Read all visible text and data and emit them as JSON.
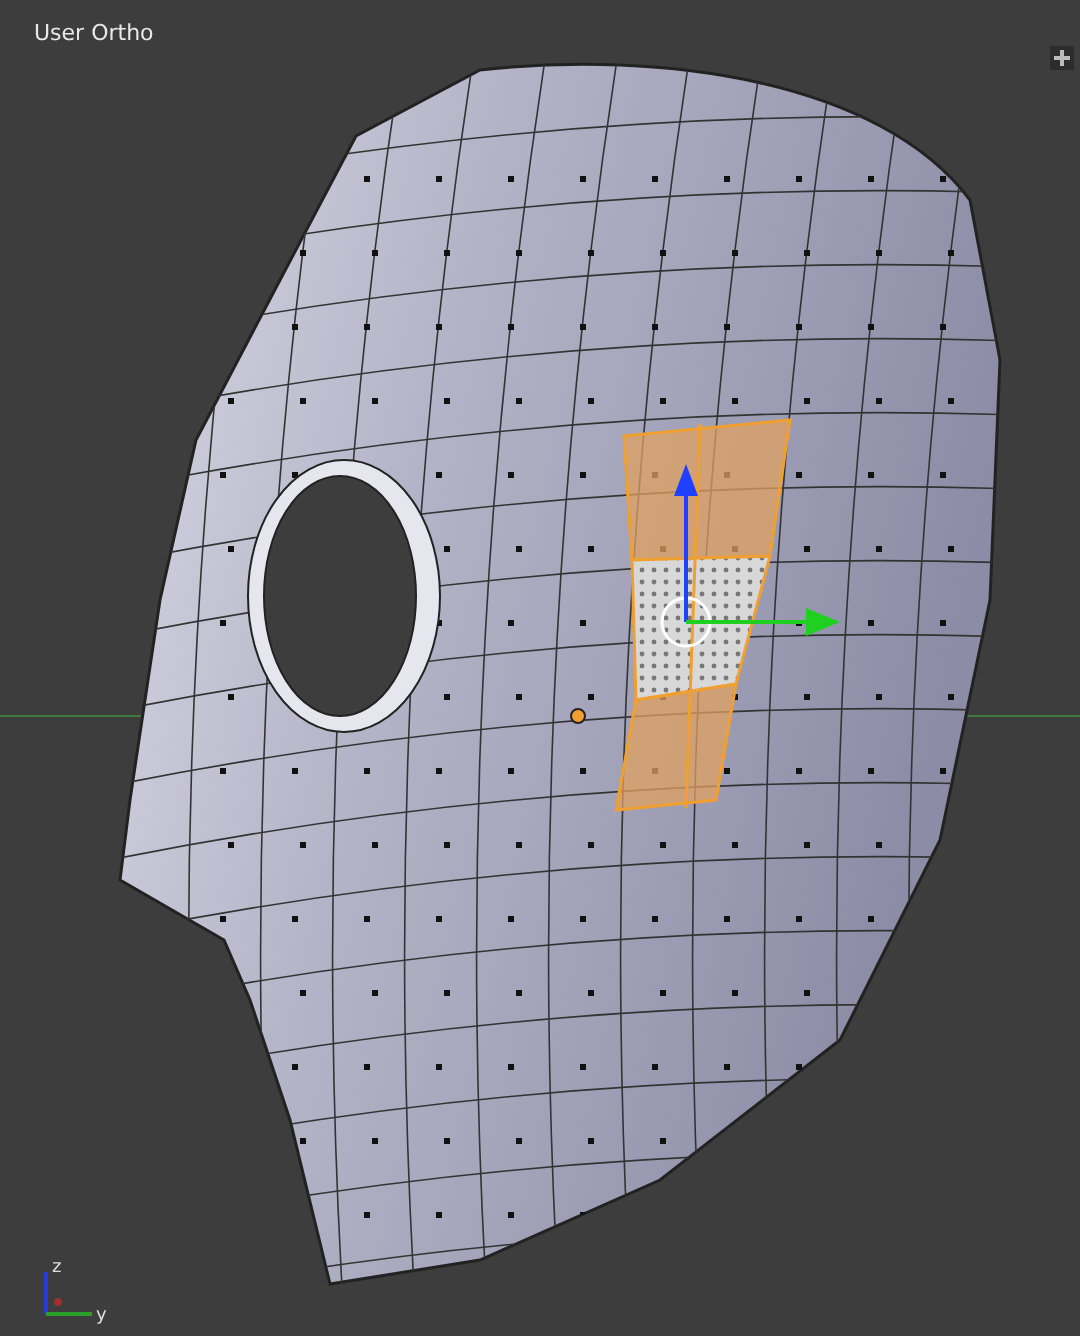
{
  "viewport": {
    "title": "User Ortho"
  },
  "axis_labels": [
    "z",
    "y"
  ]
}
